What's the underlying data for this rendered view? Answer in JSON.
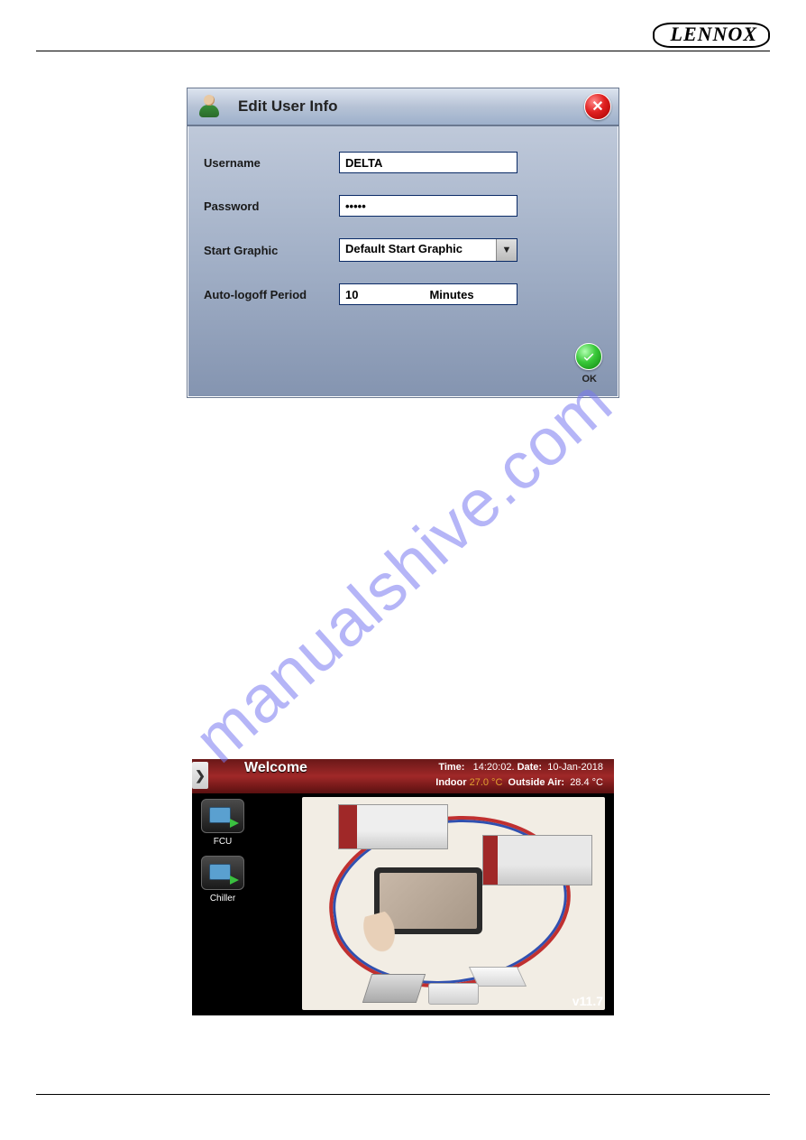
{
  "brand": "LENNOX",
  "watermark": "manualshive.com",
  "dialog": {
    "title": "Edit User Info",
    "close_symbol": "✕",
    "fields": {
      "username": {
        "label": "Username",
        "value": "DELTA"
      },
      "password": {
        "label": "Password",
        "value": "•••••"
      },
      "start_graphic": {
        "label": "Start Graphic",
        "value": "Default Start Graphic"
      },
      "autologoff": {
        "label": "Auto-logoff Period",
        "value": "10",
        "unit": "Minutes"
      }
    },
    "ok_label": "OK"
  },
  "welcome": {
    "title": "Welcome",
    "time_label": "Time:",
    "time_value": "14:20:02.",
    "date_label": "Date:",
    "date_value": "10-Jan-2018",
    "indoor_label": "Indoor",
    "indoor_value": "27.0 °C",
    "outside_label": "Outside Air:",
    "outside_value": "28.4 °C",
    "nav": {
      "fcu": "FCU",
      "chiller": "Chiller"
    },
    "version": "v11.7",
    "expand_symbol": "❯"
  }
}
